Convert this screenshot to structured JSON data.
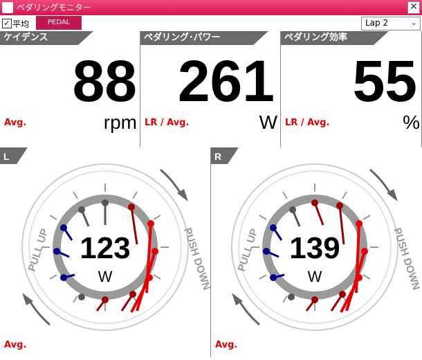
{
  "window": {
    "title": "ペダリングモニター",
    "close_glyph": "✕"
  },
  "toolbar": {
    "average_checkbox_checked": true,
    "average_label": "平均",
    "brand_text": "PEDAL",
    "lap_select_value": "Lap 2"
  },
  "panels": [
    {
      "label": "ケイデンス",
      "value": "88",
      "unit": "rpm",
      "avg_label": "Avg."
    },
    {
      "label": "ペダリング･パワー",
      "value": "261",
      "unit": "W",
      "avg_label": "LR / Avg."
    },
    {
      "label": "ペダリング効率",
      "value": "55",
      "unit": "%",
      "avg_label": "LR / Avg."
    }
  ],
  "gauges": {
    "left": {
      "side": "L",
      "value": "123",
      "unit": "W",
      "avg_label": "Avg.",
      "pull_up": "PULL UP",
      "push_down": "PUSH DOWN"
    },
    "right": {
      "side": "R",
      "value": "139",
      "unit": "W",
      "avg_label": "Avg.",
      "pull_up": "PULL UP",
      "push_down": "PUSH DOWN"
    }
  },
  "colors": {
    "title_bar": "#d71550",
    "accent_red": "#e60000",
    "dark_red": "#9b0000",
    "navy": "#00008b",
    "gray_ring": "#9a9a9a",
    "panel_header": "#6a6a6a"
  }
}
